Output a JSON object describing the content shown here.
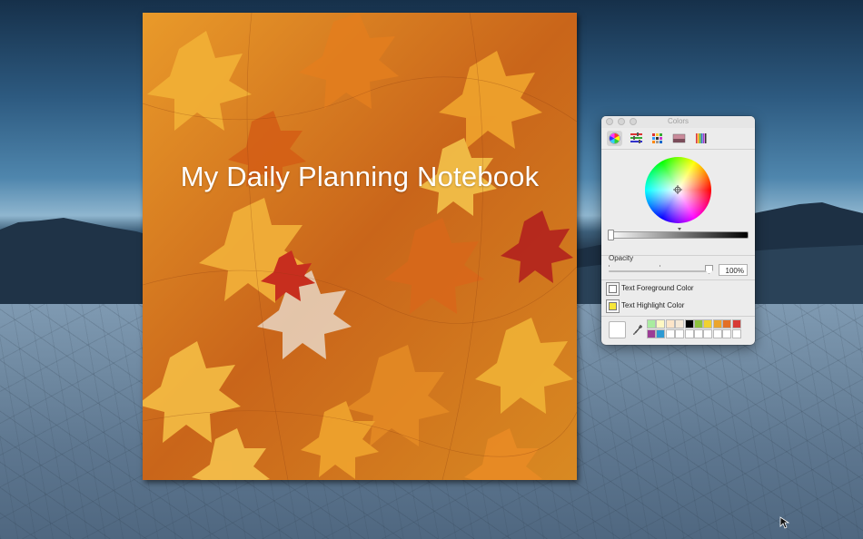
{
  "notebook": {
    "title": "My Daily Planning Notebook"
  },
  "colors_panel": {
    "title": "Colors",
    "toolbar": [
      {
        "name": "color-wheel-tab",
        "selected": true
      },
      {
        "name": "color-sliders-tab",
        "selected": false
      },
      {
        "name": "color-palettes-tab",
        "selected": false
      },
      {
        "name": "image-palettes-tab",
        "selected": false
      },
      {
        "name": "pencils-tab",
        "selected": false
      }
    ],
    "opacity_label": "Opacity",
    "opacity_value": "100%",
    "text_foreground_label": "Text Foreground Color",
    "text_highlight_label": "Text Highlight Color",
    "foreground_color": "#ffffff",
    "highlight_color": "#f7e73a",
    "swatches_row1": [
      "#a9ec9f",
      "#fff8c3",
      "#fde5c8",
      "#f5e8d6",
      "#000000",
      "#8ec43e",
      "#f1d130",
      "#eba52c",
      "#e36f26",
      "#d73a36"
    ],
    "swatches_row2": [
      "#9b3c95",
      "#2d9ad3",
      "#ffffff",
      "#ffffff",
      "#ffffff",
      "#ffffff",
      "#ffffff",
      "#ffffff",
      "#ffffff",
      "#ffffff"
    ]
  }
}
